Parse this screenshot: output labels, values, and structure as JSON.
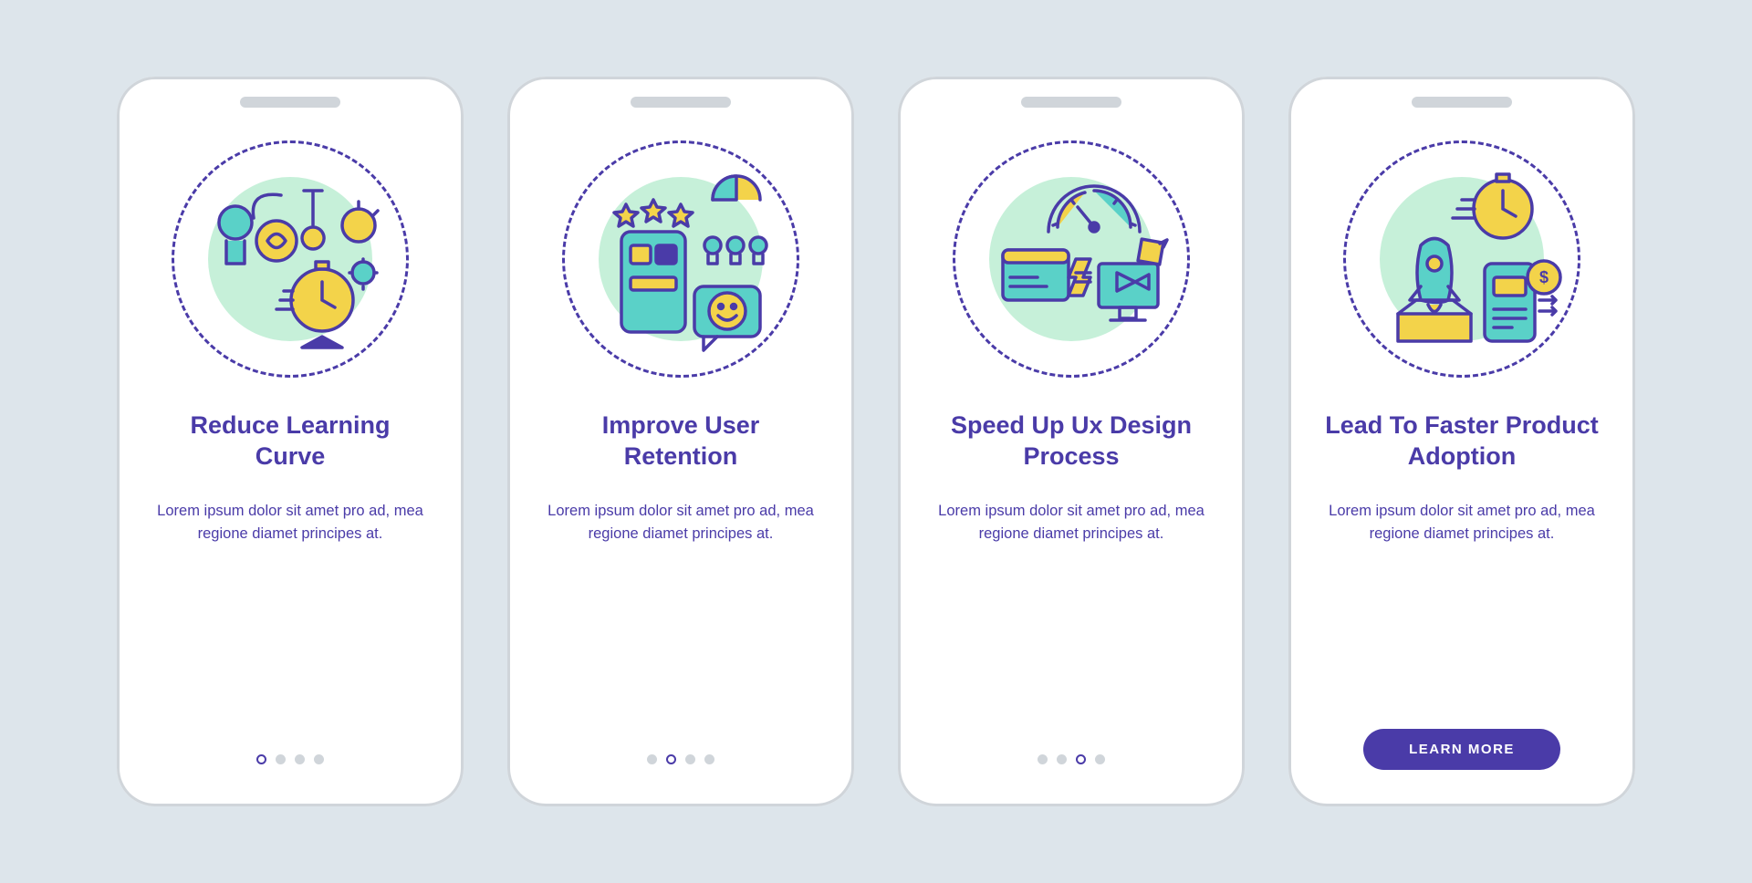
{
  "colors": {
    "background": "#dde5eb",
    "primary": "#4a3ba8",
    "mint": "#c6f0d9",
    "teal": "#5ad1c8",
    "yellow": "#f3d34a",
    "dotInactive": "#d0d5da"
  },
  "cta_label": "LEARN MORE",
  "screens": [
    {
      "title": "Reduce Learning Curve",
      "description": "Lorem ipsum dolor sit amet pro ad, mea regione diamet principes at.",
      "icon_semantic": "idea-learning-stopwatch-icon",
      "active_index": 0,
      "total_dots": 4
    },
    {
      "title": "Improve User Retention",
      "description": "Lorem ipsum dolor sit amet pro ad, mea regione diamet principes at.",
      "icon_semantic": "stars-rating-smile-feedback-icon",
      "active_index": 1,
      "total_dots": 4
    },
    {
      "title": "Speed Up Ux Design Process",
      "description": "Lorem ipsum dolor sit amet pro ad, mea regione diamet principes at.",
      "icon_semantic": "gauge-hourglass-process-icon",
      "active_index": 2,
      "total_dots": 4
    },
    {
      "title": "Lead To Faster Product Adoption",
      "description": "Lorem ipsum dolor sit amet pro ad, mea regione diamet principes at.",
      "icon_semantic": "rocket-clock-money-launch-icon",
      "active_index": 3,
      "total_dots": 4
    }
  ]
}
